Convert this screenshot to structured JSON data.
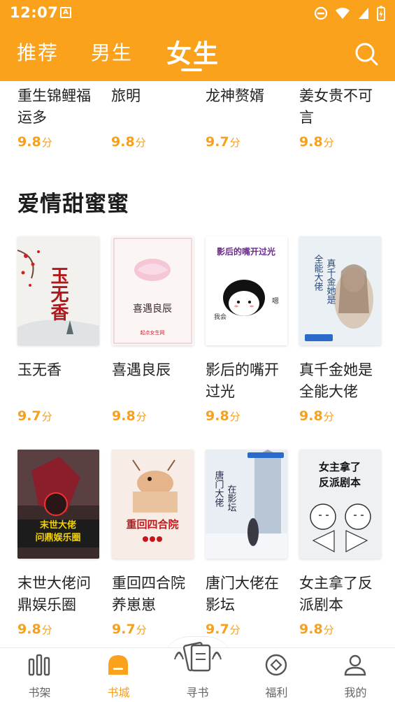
{
  "status": {
    "time": "12:07",
    "app_badge": "A"
  },
  "header": {
    "tabs": [
      {
        "label": "推荐"
      },
      {
        "label": "男生"
      },
      {
        "label": "女生"
      }
    ],
    "active_tab": "女生",
    "accent": "#fba21c"
  },
  "top_row": [
    {
      "title_l1": "重生锦鲤福",
      "title_l2": "运多",
      "score": "9.8",
      "unit": "分"
    },
    {
      "title_l1": "旅明",
      "title_l2": "",
      "score": "9.8",
      "unit": "分"
    },
    {
      "title_l1": "龙神赘婿",
      "title_l2": "",
      "score": "9.7",
      "unit": "分"
    },
    {
      "title_l1": "姜女贵不可",
      "title_l2": "言",
      "score": "9.8",
      "unit": "分"
    }
  ],
  "section": {
    "title": "爱情甜蜜蜜"
  },
  "books": [
    {
      "title_l1": "玉无香",
      "title_l2": "",
      "score": "9.7",
      "unit": "分",
      "cover_text": "玉无香"
    },
    {
      "title_l1": "喜遇良辰",
      "title_l2": "",
      "score": "9.8",
      "unit": "分",
      "cover_text": "喜遇良辰"
    },
    {
      "title_l1": "影后的嘴开",
      "title_l2": "过光",
      "score": "9.8",
      "unit": "分",
      "cover_text": "影后的嘴开过光"
    },
    {
      "title_l1": "真千金她是",
      "title_l2": "全能大佬",
      "score": "9.8",
      "unit": "分",
      "cover_text": "真千金她是全能大佬"
    },
    {
      "title_l1": "末世大佬问",
      "title_l2": "鼎娱乐圈",
      "score": "9.8",
      "unit": "分",
      "cover_text": "末世大佬问鼎娱乐圈"
    },
    {
      "title_l1": "重回四合院",
      "title_l2": "养崽崽",
      "score": "9.7",
      "unit": "分",
      "cover_text": "重回四合院"
    },
    {
      "title_l1": "唐门大佬在",
      "title_l2": "影坛",
      "score": "9.7",
      "unit": "分",
      "cover_text": "唐门大佬在影坛"
    },
    {
      "title_l1": "女主拿了反",
      "title_l2": "派剧本",
      "score": "9.8",
      "unit": "分",
      "cover_text": "女主拿了反派剧本"
    }
  ],
  "bottom_nav": [
    {
      "label": "书架",
      "icon": "bookshelf-icon"
    },
    {
      "label": "书城",
      "icon": "bookstore-icon"
    },
    {
      "label": "寻书",
      "icon": "find-book-icon"
    },
    {
      "label": "福利",
      "icon": "coin-icon"
    },
    {
      "label": "我的",
      "icon": "profile-icon"
    }
  ]
}
